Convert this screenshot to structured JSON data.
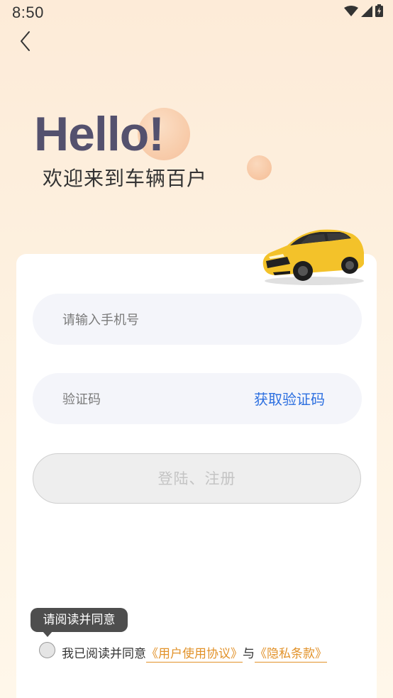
{
  "status_bar": {
    "time": "8:50"
  },
  "header": {
    "hello": "Hello!",
    "welcome": "欢迎来到车辆百户"
  },
  "form": {
    "phone_placeholder": "请输入手机号",
    "code_placeholder": "验证码",
    "get_code_label": "获取验证码",
    "login_label": "登陆、注册"
  },
  "agreement": {
    "tooltip": "请阅读并同意",
    "prefix": "我已阅读并同意",
    "user_agreement": "《用户使用协议》",
    "conjunction": "与",
    "privacy_policy": "《隐私条款》"
  },
  "colors": {
    "accent_link": "#2c6fe0",
    "agreement_link": "#e2922a",
    "hello_text": "#54516e"
  }
}
